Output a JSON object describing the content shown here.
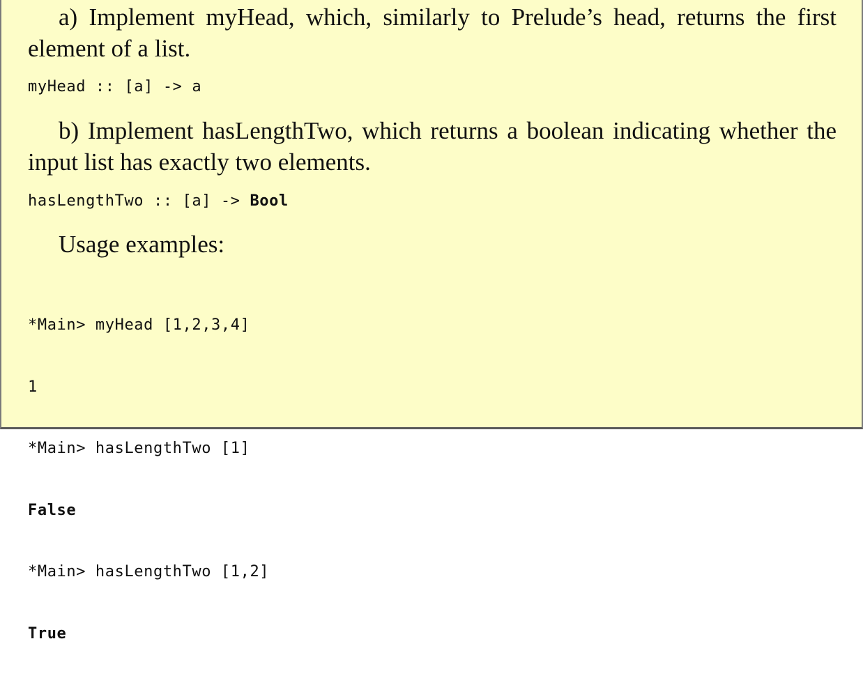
{
  "part_a": {
    "label": "a)",
    "text": "Implement myHead, which, similarly to Prelude’s head, returns the first element of a list.",
    "signature_code": "myHead :: [a] -> a"
  },
  "part_b": {
    "label": "b)",
    "text": "Implement hasLengthTwo, which returns a boolean indicating whether the input list has exactly two elements.",
    "signature_code": "hasLengthTwo :: [a] -> ",
    "signature_type": "Bool"
  },
  "usage": {
    "heading": "Usage examples:",
    "lines": [
      "*Main> myHead [1,2,3,4]",
      "1",
      "*Main> hasLengthTwo [1]",
      "False",
      "*Main> hasLengthTwo [1,2]",
      "True"
    ]
  }
}
